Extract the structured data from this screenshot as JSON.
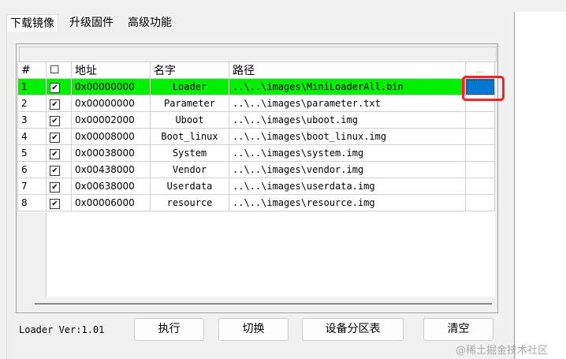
{
  "tabs": [
    "下载镜像",
    "升级固件",
    "高级功能"
  ],
  "table": {
    "headers": [
      "#",
      "☐",
      "地址",
      "名字",
      "路径",
      "..."
    ],
    "rows": [
      {
        "n": "1",
        "addr": "0x00000000",
        "name": "Loader",
        "path": "..\\..\\images\\MiniLoaderAll.bin"
      },
      {
        "n": "2",
        "addr": "0x00000000",
        "name": "Parameter",
        "path": "..\\..\\images\\parameter.txt"
      },
      {
        "n": "3",
        "addr": "0x00002000",
        "name": "Uboot",
        "path": "..\\..\\images\\uboot.img"
      },
      {
        "n": "4",
        "addr": "0x00008000",
        "name": "Boot_linux",
        "path": "..\\..\\images\\boot_linux.img"
      },
      {
        "n": "5",
        "addr": "0x00038000",
        "name": "System",
        "path": "..\\..\\images\\system.img"
      },
      {
        "n": "6",
        "addr": "0x00438000",
        "name": "Vendor",
        "path": "..\\..\\images\\vendor.img"
      },
      {
        "n": "7",
        "addr": "0x00638000",
        "name": "Userdata",
        "path": "..\\..\\images\\userdata.img"
      },
      {
        "n": "8",
        "addr": "0x00006000",
        "name": "resource",
        "path": "..\\..\\images\\resource.img"
      }
    ]
  },
  "loader_version": "Loader Ver:1.01",
  "buttons": {
    "run": "执行",
    "switch": "切换",
    "partition": "设备分区表",
    "clear": "清空"
  },
  "watermark": "@稀土掘金技术社区",
  "colors": {
    "selected_row": "#00f000",
    "browse_cell": "#0078d7",
    "highlight_box": "#ff2020"
  }
}
